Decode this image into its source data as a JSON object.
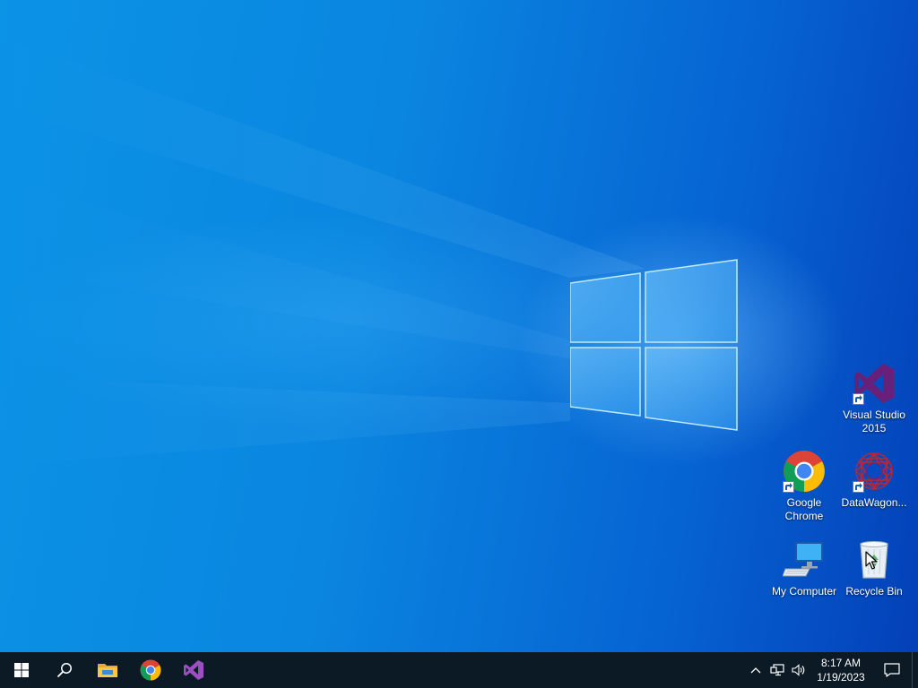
{
  "desktop": {
    "icons": [
      {
        "label": "Visual Studio 2015",
        "icon": "visual-studio-icon",
        "shortcut": true
      },
      {
        "label": "Google Chrome",
        "icon": "chrome-icon",
        "shortcut": true
      },
      {
        "label": "DataWagon...",
        "icon": "datawagon-icon",
        "shortcut": true
      },
      {
        "label": "My Computer",
        "icon": "computer-icon",
        "shortcut": false
      },
      {
        "label": "Recycle Bin",
        "icon": "recycle-bin-icon",
        "shortcut": false
      }
    ]
  },
  "taskbar": {
    "pinned": [
      {
        "icon": "windows-start-icon"
      },
      {
        "icon": "search-icon"
      },
      {
        "icon": "file-explorer-icon"
      },
      {
        "icon": "chrome-icon"
      },
      {
        "icon": "visual-studio-icon"
      }
    ],
    "tray": {
      "icons": [
        "chevron-up-icon",
        "network-icon",
        "volume-icon"
      ],
      "time": "8:17 AM",
      "date": "1/19/2023"
    }
  },
  "colors": {
    "taskbar_bg": "#0c1a26",
    "desktop_accent": "#0a86e0",
    "vs_purple": "#68217a"
  }
}
